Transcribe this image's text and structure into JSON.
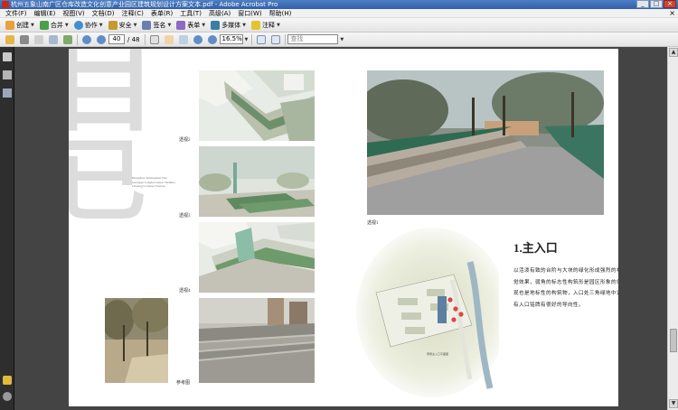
{
  "window": {
    "title": "杭州五象山南广区仓库改造文化创意产业园区建筑规划设计方案文本.pdf - Adobe Acrobat Pro",
    "minimize": "_",
    "maximize": "□",
    "close": "×"
  },
  "menu": {
    "items": [
      "文件(F)",
      "编辑(E)",
      "视图(V)",
      "文档(D)",
      "注释(C)",
      "表单(R)",
      "工具(T)",
      "高级(A)",
      "窗口(W)",
      "帮助(H)"
    ],
    "close": "×"
  },
  "toolbar1": {
    "create": "创建",
    "combine": "合并",
    "collaborate": "协作",
    "secure": "安全",
    "sign": "签名",
    "forms": "表单",
    "multimedia": "多媒体",
    "comment": "注释"
  },
  "toolbar2": {
    "current_page": "40",
    "total_pages": "/ 48",
    "zoom": "16.5%",
    "find_placeholder": "查找"
  },
  "page": {
    "big_chars": [
      "目",
      "已"
    ],
    "small_text": "Hangzhou Yuhangshan Nan Guangqu Cangku Gaizao Wenhua Chuangyi Chanye Yuanqu",
    "captions": {
      "view2": "透视2",
      "view3": "透视3",
      "view4": "透视4",
      "reference": "参考图",
      "view1": "透视1"
    },
    "section_title": "1.主入口",
    "section_body": "以活泼有致的台阶与大块的绿化形成强烈的视觉效果，弱角的标志性构筑形是园区形象的体现也是地标性的构筑物，入口处三角绿地中设有入口铭牌有很好的导向性。",
    "plan_label": "南侧主入口平面图"
  },
  "colors": {
    "titlebar": "#3b6fb8",
    "doc_background": "#444444",
    "nav_pane": "#2e2e2e"
  },
  "icons": {
    "create": "create-icon",
    "combine": "combine-icon",
    "collaborate": "collaborate-icon",
    "secure": "lock-icon",
    "sign": "pen-icon",
    "forms": "form-icon",
    "multimedia": "film-icon",
    "comment": "comment-icon",
    "open": "folder-icon",
    "print": "printer-icon",
    "email": "email-icon",
    "prev": "up-arrow-icon",
    "next": "down-arrow-icon",
    "select": "cursor-icon",
    "hand": "hand-icon",
    "zoom_out": "zoom-out-icon",
    "zoom_in": "zoom-in-icon",
    "fit_page": "fit-page-icon",
    "fit_width": "fit-width-icon"
  }
}
